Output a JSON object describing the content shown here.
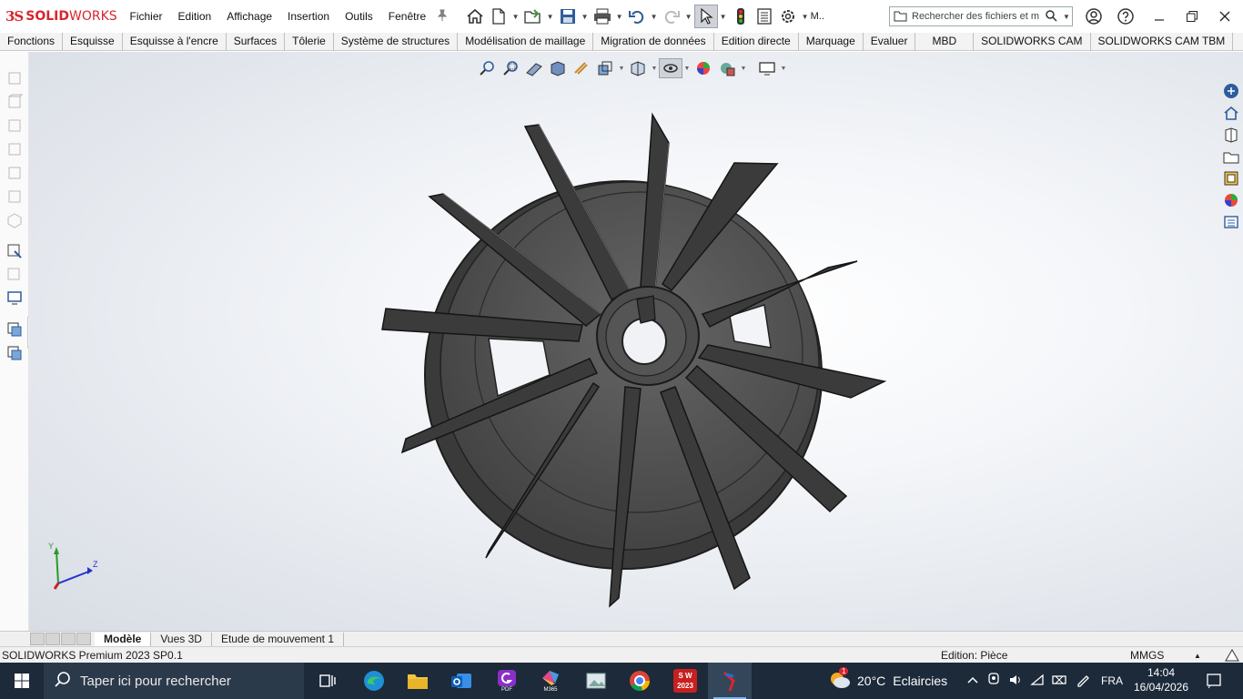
{
  "app": {
    "logo_ds": "3S",
    "logo_text_bold": "SOLID",
    "logo_text_light": "WORKS"
  },
  "menu": [
    "Fichier",
    "Edition",
    "Affichage",
    "Insertion",
    "Outils",
    "Fenêtre"
  ],
  "toolbar": {
    "user_short": "M..",
    "search_placeholder": "Rechercher des fichiers et m"
  },
  "ribbon_tabs": [
    "Fonctions",
    "Esquisse",
    "Esquisse à l'encre",
    "Surfaces",
    "Tôlerie",
    "Système de structures",
    "Modélisation de maillage",
    "Migration de données",
    "Edition directe",
    "Marquage",
    "Evaluer",
    "MBD",
    "SOLIDWORKS CAM",
    "SOLIDWORKS CAM TBM"
  ],
  "viewport": {
    "triad": {
      "y": "Y",
      "z": "Z"
    },
    "model_color": "#4a4a4a",
    "background": "#eef1f5"
  },
  "bottom_tabs": [
    "Modèle",
    "Vues 3D",
    "Etude de mouvement 1"
  ],
  "status": {
    "product": "SOLIDWORKS Premium 2023 SP0.1",
    "mode": "Edition: Pièce",
    "units": "MMGS"
  },
  "taskbar": {
    "search_placeholder": "Taper ici pour rechercher",
    "weather_badge": "1",
    "temperature": "20°C",
    "weather": "Eclaircies",
    "language": "FRA",
    "time": "14:04",
    "date": "16/04/2026",
    "pdf_label": "PDF",
    "m365_label": "M365",
    "sw_label": "S W",
    "sw_year": "2023"
  }
}
